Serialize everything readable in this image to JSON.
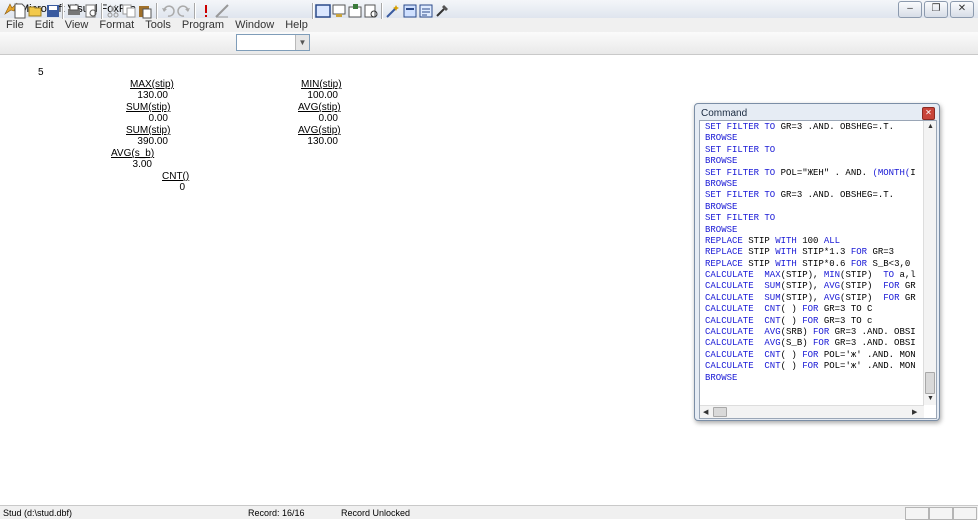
{
  "window": {
    "title": "Microsoft Visual FoxPro"
  },
  "menu": [
    "File",
    "Edit",
    "View",
    "Format",
    "Tools",
    "Program",
    "Window",
    "Help"
  ],
  "toolbar": {
    "combo_value": ""
  },
  "output": {
    "record_number": "5",
    "left": [
      {
        "label": "MAX(stip)",
        "value": "130.00"
      },
      {
        "label": "SUM(stip)",
        "value": "0.00"
      },
      {
        "label": "SUM(stip)",
        "value": "390.00"
      },
      {
        "label": "AVG(s_b)",
        "value": "3.00"
      },
      {
        "label": "CNT()",
        "value": "0"
      }
    ],
    "right": [
      {
        "label": "MIN(stip)",
        "value": "100.00"
      },
      {
        "label": "AVG(stip)",
        "value": "0.00"
      },
      {
        "label": "AVG(stip)",
        "value": "130.00"
      }
    ]
  },
  "command_window": {
    "title": "Command",
    "lines": [
      [
        [
          "kw",
          "SET FILTER TO "
        ],
        [
          "tx",
          "GR=3 .AND. OBSHEG=.T."
        ]
      ],
      [
        [
          "kw",
          "BROWSE"
        ]
      ],
      [
        [
          "kw",
          "SET FILTER TO"
        ]
      ],
      [
        [
          "kw",
          "BROWSE"
        ]
      ],
      [
        [
          "kw",
          "SET FILTER TO "
        ],
        [
          "tx",
          "POL=\"ЖЕН\" . AND. "
        ],
        [
          "kw",
          "(MONTH("
        ],
        [
          "tx",
          "I"
        ]
      ],
      [
        [
          "kw",
          "BROWSE"
        ]
      ],
      [
        [
          "kw",
          "SET FILTER TO "
        ],
        [
          "tx",
          "GR=3 .AND. OBSHEG=.T."
        ]
      ],
      [
        [
          "kw",
          "BROWSE"
        ]
      ],
      [
        [
          "kw",
          "SET FILTER TO"
        ]
      ],
      [
        [
          "kw",
          "BROWSE"
        ]
      ],
      [
        [
          "kw",
          "REPLACE "
        ],
        [
          "tx",
          "STIP "
        ],
        [
          "kw",
          "WITH "
        ],
        [
          "tx",
          "100 "
        ],
        [
          "kw",
          "ALL"
        ]
      ],
      [
        [
          "kw",
          "REPLACE "
        ],
        [
          "tx",
          "STIP "
        ],
        [
          "kw",
          "WITH "
        ],
        [
          "tx",
          "STIP*1.3 "
        ],
        [
          "kw",
          "FOR "
        ],
        [
          "tx",
          "GR=3"
        ]
      ],
      [
        [
          "kw",
          "REPLACE "
        ],
        [
          "tx",
          "STIP "
        ],
        [
          "kw",
          "WITH "
        ],
        [
          "tx",
          "STIP*0.6 "
        ],
        [
          "kw",
          "FOR "
        ],
        [
          "tx",
          "S_B<3,0"
        ]
      ],
      [
        [
          "kw",
          "CALCULATE  MAX"
        ],
        [
          "tx",
          "(STIP), "
        ],
        [
          "kw",
          "MIN"
        ],
        [
          "tx",
          "(STIP)  "
        ],
        [
          "kw",
          "TO "
        ],
        [
          "tx",
          "a,l"
        ]
      ],
      [
        [
          "kw",
          "CALCULATE  SUM"
        ],
        [
          "tx",
          "(STIP), "
        ],
        [
          "kw",
          "AVG"
        ],
        [
          "tx",
          "(STIP)  "
        ],
        [
          "kw",
          "FOR "
        ],
        [
          "tx",
          "GR"
        ]
      ],
      [
        [
          "kw",
          "CALCULATE  SUM"
        ],
        [
          "tx",
          "(STIP), "
        ],
        [
          "kw",
          "AVG"
        ],
        [
          "tx",
          "(STIP)  "
        ],
        [
          "kw",
          "FOR "
        ],
        [
          "tx",
          "GR"
        ]
      ],
      [
        [
          "kw",
          "CALCULATE  CNT"
        ],
        [
          "tx",
          "( ) "
        ],
        [
          "kw",
          "FOR "
        ],
        [
          "tx",
          "GR=3 TO C"
        ]
      ],
      [
        [
          "kw",
          "CALCULATE  CNT"
        ],
        [
          "tx",
          "( ) "
        ],
        [
          "kw",
          "FOR "
        ],
        [
          "tx",
          "GR=3 TO c"
        ]
      ],
      [
        [
          "kw",
          "CALCULATE  AVG"
        ],
        [
          "tx",
          "(SRB) "
        ],
        [
          "kw",
          "FOR "
        ],
        [
          "tx",
          "GR=3 .AND. OBSI"
        ]
      ],
      [
        [
          "kw",
          "CALCULATE  AVG"
        ],
        [
          "tx",
          "(S_B) "
        ],
        [
          "kw",
          "FOR "
        ],
        [
          "tx",
          "GR=3 .AND. OBSI"
        ]
      ],
      [
        [
          "kw",
          "CALCULATE  CNT"
        ],
        [
          "tx",
          "( ) "
        ],
        [
          "kw",
          "FOR "
        ],
        [
          "tx",
          "POL='ж' .AND. MON"
        ]
      ],
      [
        [
          "kw",
          "CALCULATE  CNT"
        ],
        [
          "tx",
          "( ) "
        ],
        [
          "kw",
          "FOR "
        ],
        [
          "tx",
          "POL='ж' .AND. MON"
        ]
      ],
      [
        [
          "kw",
          "BROWSE"
        ]
      ]
    ]
  },
  "statusbar": {
    "table": "Stud (d:\\stud.dbf)",
    "record": "Record: 16/16",
    "lock": "Record Unlocked"
  }
}
